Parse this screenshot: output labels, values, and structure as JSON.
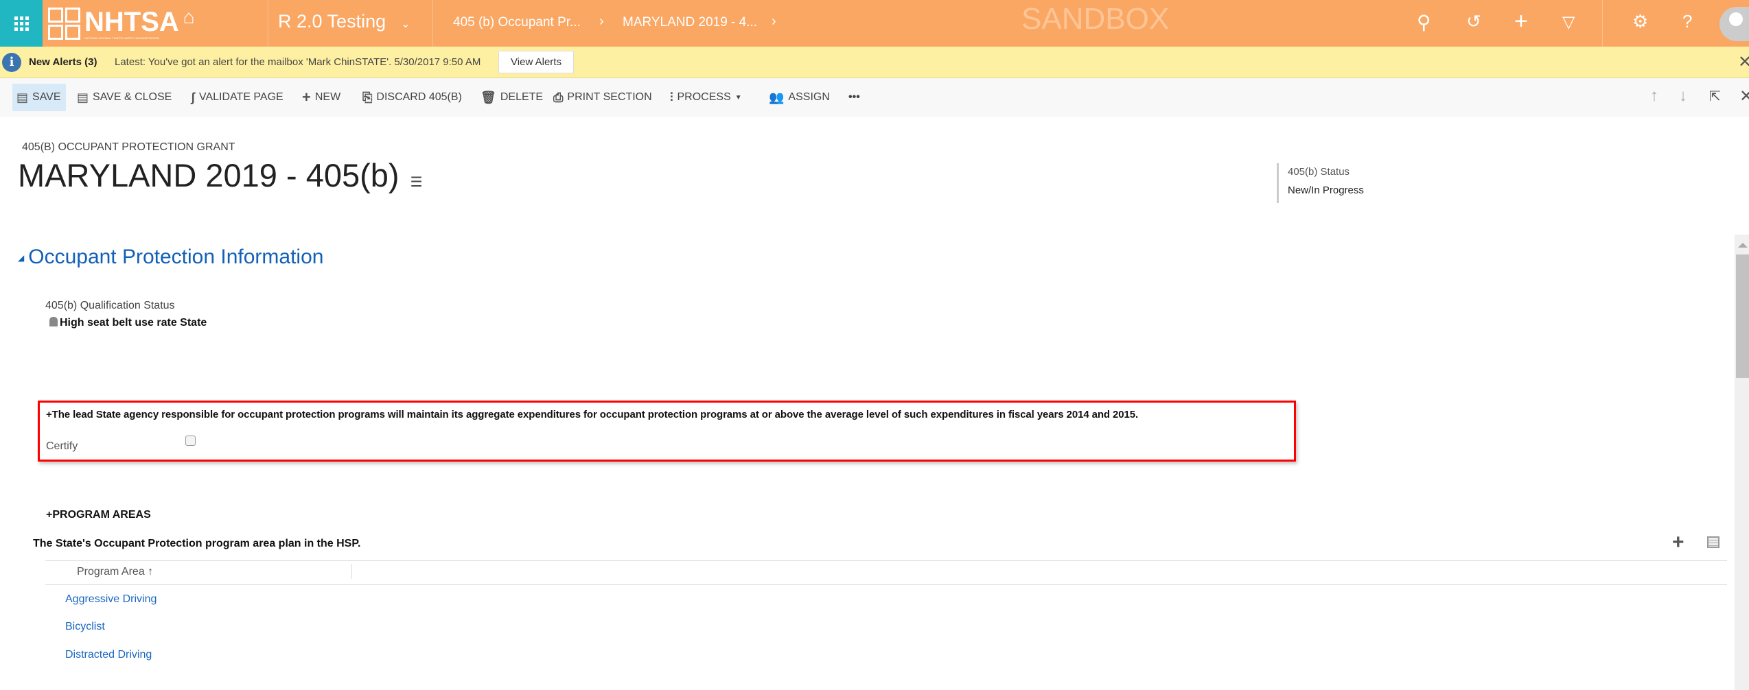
{
  "header": {
    "logo_text": "NHTSA",
    "logo_subtext": "NATIONAL HIGHWAY TRAFFIC SAFETY ADMINISTRATION",
    "app_name": "R 2.0 Testing",
    "breadcrumbs": [
      "405 (b) Occupant Pr...",
      "MARYLAND 2019 - 4..."
    ],
    "watermark": "SANDBOX"
  },
  "alert": {
    "title": "New Alerts (3)",
    "message": "Latest: You've got an alert for the mailbox 'Mark ChinSTATE'. 5/30/2017 9:50 AM",
    "button": "View Alerts"
  },
  "toolbar": {
    "save": "SAVE",
    "save_close": "SAVE & CLOSE",
    "validate": "VALIDATE PAGE",
    "new": "NEW",
    "discard": "DISCARD 405(B)",
    "delete": "DELETE",
    "print": "PRINT SECTION",
    "process": "PROCESS",
    "assign": "ASSIGN",
    "more": "•••"
  },
  "record": {
    "entity": "405(B) OCCUPANT PROTECTION GRANT",
    "title": "MARYLAND 2019 - 405(b)",
    "status_label": "405(b) Status",
    "status_value": "New/In Progress"
  },
  "section": {
    "title": "Occupant Protection Information",
    "qual_label": "405(b) Qualification Status",
    "qual_value": "High seat belt use rate State",
    "certify_text": "+The lead State agency responsible for occupant protection programs will maintain its aggregate expenditures for occupant protection programs at or above the average level of such expenditures in fiscal years 2014 and 2015.",
    "certify_label": "Certify",
    "certify_checked": false,
    "program_heading": "+PROGRAM AREAS",
    "program_subtitle": "The State's Occupant Protection program area plan in the HSP.",
    "grid_column": "Program Area",
    "sort_icon": "↑",
    "rows": [
      "Aggressive Driving",
      "Bicyclist",
      "Distracted Driving"
    ]
  },
  "colors": {
    "header": "#fba764",
    "apps": "#20b6c2",
    "alert": "#fef0a2",
    "link": "#1a67c0",
    "highlight": "#ff0000"
  }
}
